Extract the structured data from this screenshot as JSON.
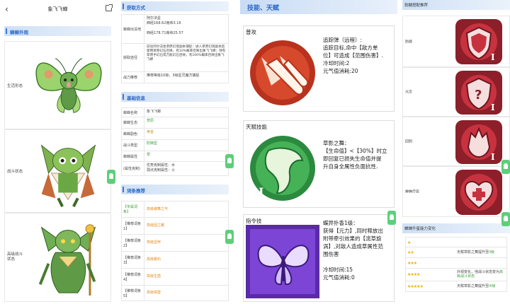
{
  "panel1": {
    "title": "象飞飞蝉",
    "section_title": "蝉蝉外观",
    "forms": [
      {
        "label": "生活形态"
      },
      {
        "label": "战斗状态"
      },
      {
        "label": "高级战斗状态"
      }
    ]
  },
  "panel2": {
    "acquire_title": "获取方式",
    "acquire_rows": [
      {
        "key": "蝉蝉出没地",
        "value": "阿尔法星\n西经168.62南纬3.16\n\n西经178.71南纬25.57"
      },
      {
        "key": "获取途径",
        "value": "前往阿尔法星草原幻境副本捕捉：进入草原幻境副本后使用草原幻石召唤，有10%概率召唤出象飞飞蝉；持有草原手幻石或万能幻石召唤，有100%概率召唤出象飞飞蝉"
      },
      {
        "key": "战力推荐",
        "value": "推荐等级10级，3级星灵魔方捕捉"
      }
    ],
    "basic_title": "基础信息",
    "basic_rows": [
      {
        "key": "蝉蝉名称",
        "value": "象飞飞蝉",
        "color": ""
      },
      {
        "key": "蝉蝉生态",
        "value": "草原",
        "color": "green"
      },
      {
        "key": "蝉蝉副色",
        "value": "黄金",
        "color": "gold"
      },
      {
        "key": "战斗类型",
        "value": "防御型",
        "color": "green"
      },
      {
        "key": "蝉蝉属性",
        "value": "草",
        "color": "green"
      },
      {
        "key": "(属性克制)",
        "value": "优势克制属性：水\n弱点克制属性：火",
        "color": ""
      }
    ],
    "entry_title": "词条推荐",
    "entry_rows": [
      {
        "key": "【专属词条】",
        "value": "高级蝶舞之气"
      },
      {
        "key": "【推荐词条1】",
        "value": "高级固之翼"
      },
      {
        "key": "【推荐词条2】",
        "value": "高级坚甲"
      },
      {
        "key": "【推荐词条3】",
        "value": "高级磐石"
      },
      {
        "key": "【推荐词条4】",
        "value": "高级生盾"
      },
      {
        "key": "【推荐词条5】",
        "value": "高级铁壁"
      }
    ]
  },
  "panel3": {
    "header": "技能、天赋",
    "skills": [
      {
        "name": "普攻",
        "desc": [
          "追踪弹（远程）:",
          "追踪目标,命中【敌方单",
          "位】可造成【范围伤害】.",
          "冷却时间:2",
          "元气值消耗:20"
        ]
      },
      {
        "name": "天赋技能",
        "desc": [
          "草影之舞：",
          "【生命值】<【30%】时立",
          "即回复已损失生命值并提",
          "升自身全属性负面抗性."
        ]
      },
      {
        "name": "指令技",
        "desc": [
          "蝶异扑香1级：",
          "获得【元力】,同时释放出",
          "附带牵引效果的【流草旋",
          "涡】,对敌人造成草属性范",
          "围伤害",
          "",
          "冷却时间:15",
          "元气值消耗:0"
        ]
      }
    ]
  },
  "panel4": {
    "gem_title": "软糖搭配推荐",
    "gems": [
      {
        "label": "防御"
      },
      {
        "label": "亢灾"
      },
      {
        "label": "回刺"
      },
      {
        "label": "蝉蝉疗愈"
      }
    ],
    "star_title": "蝉蝉升星能力变化",
    "stars": [
      {
        "stars": "★",
        "desc": "",
        "highlight": ""
      },
      {
        "stars": "★★",
        "desc": "天赋草影之舞提升至",
        "highlight": "II级"
      },
      {
        "stars": "★★★",
        "desc": "",
        "highlight": ""
      },
      {
        "stars": "★★★★",
        "desc": "外观变化，他战斗状态变为",
        "highlight": "高级战斗状态"
      },
      {
        "stars": "★★★★★",
        "desc": "天赋草影之舞提升至",
        "highlight": "III级"
      }
    ]
  },
  "colors": {
    "accent": "#2a66c6",
    "green": "#3aa03a",
    "orange": "#e08a1e",
    "star": "#f0b000"
  }
}
